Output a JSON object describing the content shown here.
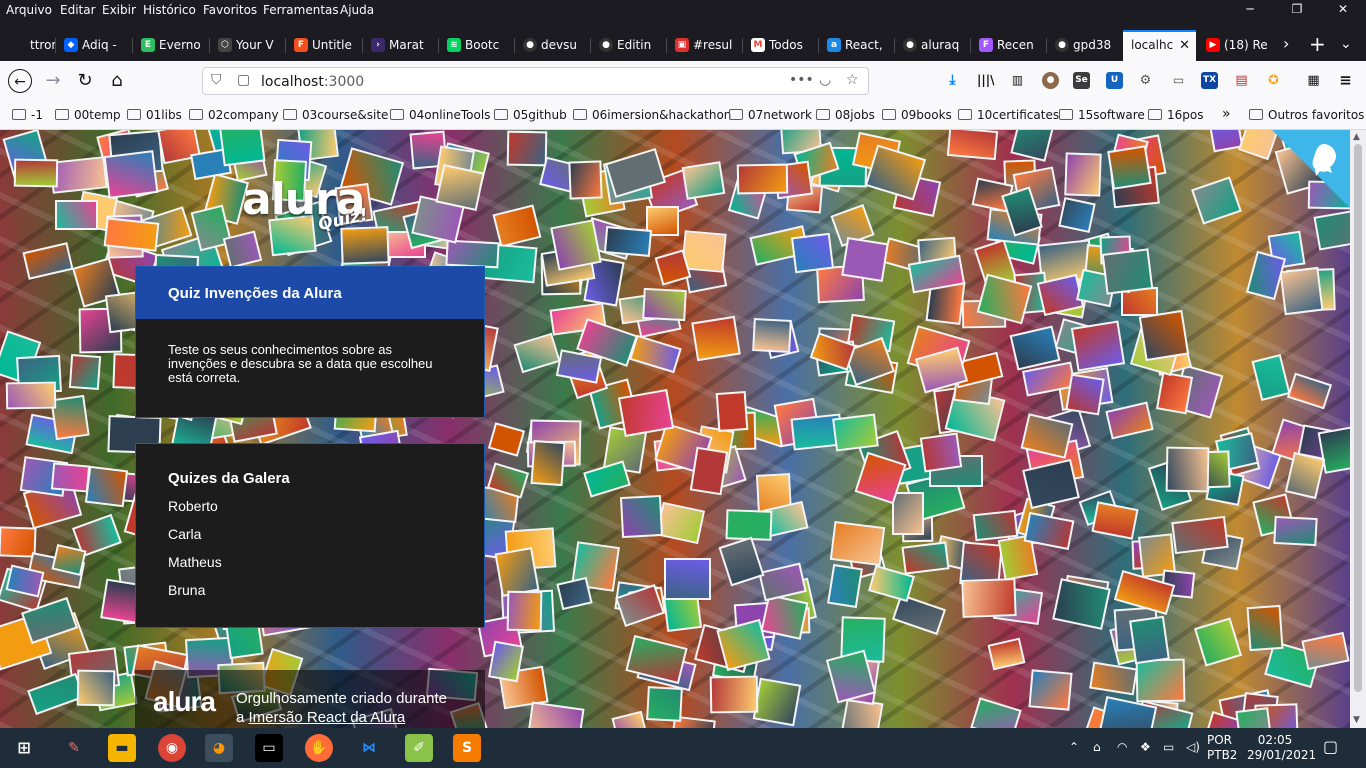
{
  "menubar": {
    "items": [
      "Arquivo",
      "Editar",
      "Exibir",
      "Histórico",
      "Favoritos",
      "Ferramentas",
      "Ajuda"
    ],
    "window_controls": [
      "minimize-icon",
      "maximize-icon",
      "close-icon"
    ]
  },
  "tabs": [
    {
      "title": "ttror",
      "icon": "generic-icon",
      "color": "#1c1b22"
    },
    {
      "title": "Adiq -",
      "icon": "dropbox-icon",
      "color": "#0061fe"
    },
    {
      "title": "Everno",
      "icon": "evernote-icon",
      "color": "#2dbe60"
    },
    {
      "title": "Your V",
      "icon": "codesandbox-icon",
      "color": "#444444"
    },
    {
      "title": "Untitle",
      "icon": "figma-icon",
      "color": "#f24e1e"
    },
    {
      "title": "Marat",
      "icon": "terminal-icon",
      "color": "#3b2a6b"
    },
    {
      "title": "Bootc",
      "icon": "rocketseat-icon",
      "color": "#04d361"
    },
    {
      "title": "devsu",
      "icon": "github-icon",
      "color": "#333333"
    },
    {
      "title": "Editin",
      "icon": "github-icon",
      "color": "#333333"
    },
    {
      "title": "#resul",
      "icon": "calendar-icon",
      "color": "#e03030"
    },
    {
      "title": "Todos",
      "icon": "gmail-icon",
      "color": "#ea4335"
    },
    {
      "title": "React,",
      "icon": "alura-icon",
      "color": "#1e88e5"
    },
    {
      "title": "aluraq",
      "icon": "github-icon",
      "color": "#333333"
    },
    {
      "title": "Recen",
      "icon": "figma-icon",
      "color": "#a259ff"
    },
    {
      "title": "gpd38",
      "icon": "github-icon",
      "color": "#333333"
    },
    {
      "title": "localhc",
      "icon": "none",
      "color": "#f9f9fb",
      "active": true
    },
    {
      "title": "(18) Re",
      "icon": "youtube-icon",
      "color": "#ff0000"
    }
  ],
  "nav": {
    "url_host": "localhost",
    "url_port": ":3000"
  },
  "bookmarks": {
    "items": [
      "-1",
      "00temp",
      "01libs",
      "02company",
      "03course&site",
      "04onlineTools",
      "05github",
      "06imersion&hackathon",
      "07network",
      "08jobs",
      "09books",
      "10certificates",
      "15software",
      "16pos"
    ],
    "other": "Outros favoritos"
  },
  "page": {
    "logo_word": "alura",
    "logo_sub": "Quiz!",
    "main_widget": {
      "title": "Quiz Invenções da Alura",
      "description": "Teste os seus conhecimentos sobre as invenções e descubra se a data que escolheu está correta."
    },
    "galera_widget": {
      "title": "Quizes da Galera",
      "items": [
        "Roberto",
        "Carla",
        "Matheus",
        "Bruna"
      ]
    },
    "footer": {
      "logo": "alura",
      "text": "Orgulhosamente criado durante",
      "prefix": "a ",
      "link": "Imersão React da Alura"
    },
    "colors": {
      "primary": "#1d4aa8",
      "widget_bg": "#1c1c1c"
    }
  },
  "taskbar": {
    "apps": [
      "paint-icon",
      "file-explorer-icon",
      "chrome-icon",
      "firefox-icon",
      "terminal-icon",
      "postman-icon",
      "vscode-icon",
      "notepad-icon",
      "sublime-icon"
    ],
    "lang_line1": "POR",
    "lang_line2": "PTB2",
    "time": "02:05",
    "date": "29/01/2021"
  }
}
